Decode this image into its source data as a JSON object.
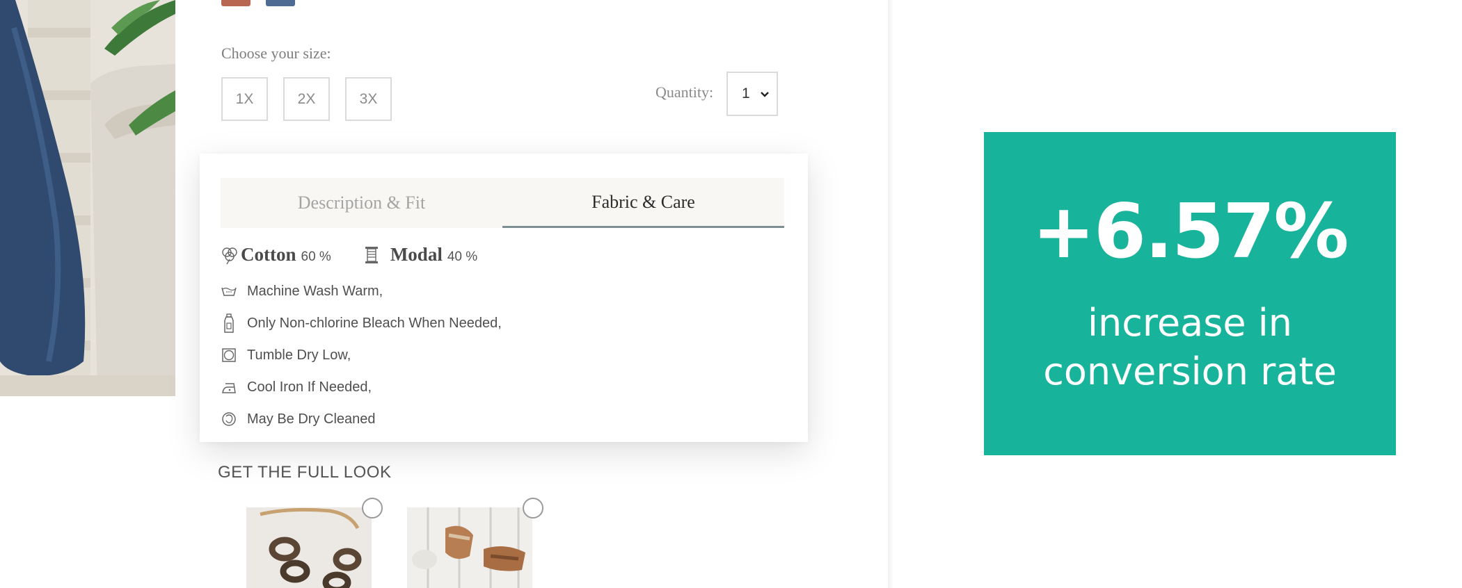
{
  "product": {
    "swatch_colors": [
      "#b86652",
      "#4e6c93"
    ],
    "size_prompt": "Choose your size:",
    "sizes": [
      "1X",
      "2X",
      "3X"
    ],
    "quantity_label": "Quantity:",
    "quantity_value": "1"
  },
  "details": {
    "tabs": [
      {
        "label": "Description & Fit",
        "active": false
      },
      {
        "label": "Fabric & Care",
        "active": true
      }
    ],
    "fabrics": [
      {
        "name": "Cotton",
        "percent": "60 %",
        "icon": "cotton-flower-icon"
      },
      {
        "name": "Modal",
        "percent": "40 %",
        "icon": "fabric-spool-icon"
      }
    ],
    "care_instructions": [
      {
        "text": "Machine Wash Warm,",
        "icon": "wash-tub-icon"
      },
      {
        "text": "Only Non-chlorine Bleach When Needed,",
        "icon": "bleach-bottle-icon"
      },
      {
        "text": "Tumble Dry Low,",
        "icon": "tumble-dry-icon"
      },
      {
        "text": "Cool Iron If Needed,",
        "icon": "iron-icon"
      },
      {
        "text": "May Be Dry Cleaned",
        "icon": "dry-clean-icon"
      }
    ]
  },
  "full_look": {
    "title": "GET THE FULL LOOK",
    "items": [
      {
        "image": "chain-necklace-image"
      },
      {
        "image": "sandals-image"
      }
    ]
  },
  "stat": {
    "value": "+6.57%",
    "caption_line1": "increase in",
    "caption_line2": "conversion rate",
    "background_color": "#17b39b"
  }
}
